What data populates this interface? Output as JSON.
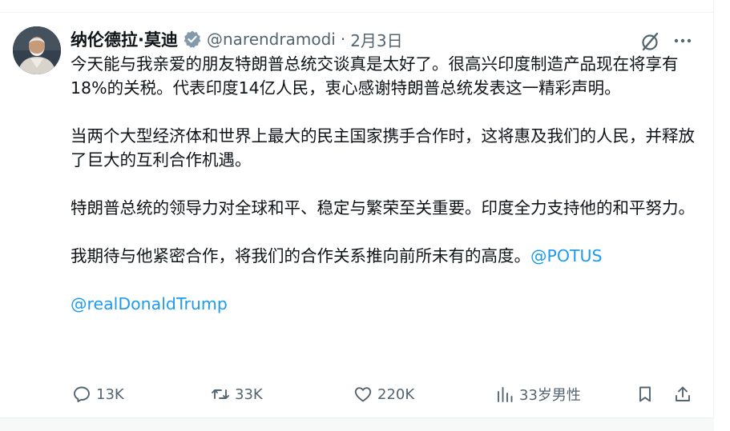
{
  "author": {
    "name": "纳伦德拉·莫迪",
    "handle": "@narendramodi",
    "separator": "·",
    "date": "2月3日",
    "verified_icon": "verified-badge-icon"
  },
  "tweet": {
    "paragraphs": [
      "今天能与我亲爱的朋友特朗普总统交谈真是太好了。很高兴印度制造产品现在将享有18%的关税。代表印度14亿人民，衷心感谢特朗普总统发表这一精彩声明。",
      "当两个大型经济体和世界上最大的民主国家携手合作时，这将惠及我们的人民，并释放了巨大的互利合作机遇。",
      "特朗普总统的领导力对全球和平、稳定与繁荣至关重要。印度全力支持他的和平努力。"
    ],
    "last_paragraph_text": "我期待与他紧密合作，将我们的合作关系推向前所未有的高度。",
    "mentions": [
      "@POTUS",
      "@realDonaldTrump"
    ]
  },
  "actions": {
    "replies": "13K",
    "retweets": "33K",
    "likes": "220K",
    "views": "33岁男性"
  },
  "colors": {
    "link": "#1d9bf0",
    "muted": "#536471",
    "text": "#0f1419",
    "verified": "#829aab"
  }
}
